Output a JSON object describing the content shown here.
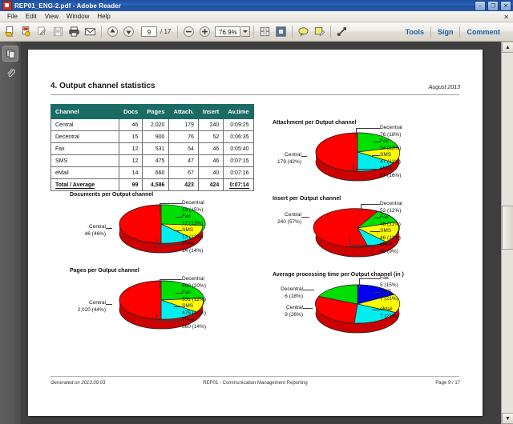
{
  "window": {
    "title": "REP01_ENG-2.pdf - Adobe Reader",
    "app_icon": "pdf-icon",
    "minimize_label": "–",
    "maximize_label": "❐",
    "close_label": "✕"
  },
  "menubar": {
    "items": [
      {
        "label": "File"
      },
      {
        "label": "Edit"
      },
      {
        "label": "View"
      },
      {
        "label": "Window"
      },
      {
        "label": "Help"
      }
    ],
    "close_doc_label": "✕"
  },
  "toolbar": {
    "icons": [
      {
        "name": "open-file-icon"
      },
      {
        "name": "create-pdf-icon"
      },
      {
        "name": "edit-pdf-icon"
      },
      {
        "name": "save-icon"
      },
      {
        "name": "print-icon"
      },
      {
        "name": "email-icon"
      },
      {
        "name": "previous-page-icon"
      },
      {
        "name": "next-page-icon"
      }
    ],
    "page_number": "9",
    "page_total": "/ 17",
    "zoom_out_icon": "zoom-out-icon",
    "zoom_in_icon": "zoom-in-icon",
    "zoom_level": "76.9%",
    "zoom_dropdown_icon": "chevron-down-icon",
    "fit_width_icon": "fit-width-icon",
    "fit_page_icon": "fit-page-icon",
    "comment_icon": "comment-balloon-icon",
    "highlight_icon": "highlight-text-icon",
    "fullscreen_icon": "fullscreen-icon",
    "right_links": [
      {
        "label": "Tools"
      },
      {
        "label": "Sign"
      },
      {
        "label": "Comment"
      }
    ]
  },
  "sidebar": {
    "items": [
      {
        "name": "page-thumbnails-icon",
        "selected": true
      },
      {
        "name": "attachments-paperclip-icon",
        "selected": false
      }
    ]
  },
  "scrollbar": {
    "up_arrow": "▲",
    "down_arrow": "▼"
  },
  "document": {
    "section_title": "4. Output channel statistics",
    "month": "August 2013",
    "table": {
      "headers": [
        "Channel",
        "Docs",
        "Pages",
        "Attach.",
        "Insert",
        "Av.time"
      ],
      "rows": [
        [
          "Central",
          "46",
          "2,020",
          "179",
          "240",
          "0:09:25"
        ],
        [
          "Decentral",
          "15",
          "900",
          "76",
          "52",
          "0:06:35"
        ],
        [
          "Fax",
          "12",
          "531",
          "54",
          "46",
          "0:05:40"
        ],
        [
          "SMS",
          "12",
          "475",
          "47",
          "46",
          "0:07:15"
        ],
        [
          "eMail",
          "14",
          "660",
          "67",
          "40",
          "0:07:16"
        ]
      ],
      "total_row": [
        "Total / Average",
        "99",
        "4,586",
        "423",
        "424",
        "0:07:14"
      ]
    },
    "footer": {
      "generated": "Generated on 2013.09.03",
      "report": "REP01 - Communication Management Reporting",
      "page": "Page 9 / 17"
    }
  },
  "colors": {
    "central": "#ff0000",
    "decentral": "#00e000",
    "fax": "#0000ee",
    "sms": "#ffff00",
    "email": "#00eeee",
    "table_header": "#1b6b65",
    "titlebar": "#1c4f9e",
    "link": "#1f5fa8"
  },
  "chart_data": [
    {
      "id": "documents",
      "type": "pie",
      "title": "Documents per Output channel",
      "categories": [
        "Central",
        "Decentral",
        "Fax",
        "SMS",
        "eMail"
      ],
      "values": [
        46,
        15,
        12,
        12,
        14
      ],
      "percents": [
        46,
        15,
        12,
        12,
        14
      ],
      "labels": [
        "Central\n46 (46%)",
        "Decentral\n15 (15%)",
        "Fax\n12 (12%)",
        "SMS\n12 (12%)",
        "eMail\n14 (14%)"
      ],
      "label_lines": [
        [
          "Central",
          "46 (46%)"
        ],
        [
          "Decentral",
          "15 (15%)"
        ],
        [
          "Fax",
          "12 (12%)"
        ],
        [
          "SMS",
          "12 (12%)"
        ],
        [
          "eMail",
          "14 (14%)"
        ]
      ],
      "colors": [
        "#ff0000",
        "#00e000",
        "#0000ee",
        "#ffff00",
        "#00eeee"
      ],
      "legend": "callout-labels"
    },
    {
      "id": "pages",
      "type": "pie",
      "title": "Pages per Output channel",
      "categories": [
        "Central",
        "Decentral",
        "Fax",
        "SMS",
        "eMail"
      ],
      "values": [
        2020,
        900,
        531,
        475,
        660
      ],
      "percents": [
        44,
        20,
        12,
        10,
        14
      ],
      "label_lines": [
        [
          "Central",
          "2,020 (44%)"
        ],
        [
          "Decentral",
          "900 (20%)"
        ],
        [
          "Fax",
          "531 (12%)"
        ],
        [
          "SMS",
          "475 (10%)"
        ],
        [
          "eMail",
          "660 (14%)"
        ]
      ],
      "colors": [
        "#ff0000",
        "#00e000",
        "#0000ee",
        "#ffff00",
        "#00eeee"
      ],
      "legend": "callout-labels"
    },
    {
      "id": "attachment",
      "type": "pie",
      "title": "Attachment per Output channel",
      "categories": [
        "Central",
        "Decentral",
        "Fax",
        "SMS",
        "eMail"
      ],
      "values": [
        179,
        76,
        54,
        47,
        67
      ],
      "percents": [
        42,
        18,
        13,
        11,
        16
      ],
      "label_lines": [
        [
          "Central",
          "179 (42%)"
        ],
        [
          "Decentral",
          "76 (18%)"
        ],
        [
          "Fax",
          "54 (13%)"
        ],
        [
          "SMS",
          "47 (11%)"
        ],
        [
          "eMail",
          "67 (16%)"
        ]
      ],
      "colors": [
        "#ff0000",
        "#00e000",
        "#0000ee",
        "#ffff00",
        "#00eeee"
      ],
      "legend": "callout-labels"
    },
    {
      "id": "insert",
      "type": "pie",
      "title": "Insert per Output channel",
      "categories": [
        "Central",
        "Decentral",
        "Fax",
        "SMS",
        "eMail"
      ],
      "values": [
        240,
        52,
        46,
        46,
        40
      ],
      "percents": [
        57,
        12,
        11,
        11,
        9
      ],
      "label_lines": [
        [
          "Central",
          "240 (57%)"
        ],
        [
          "Decentral",
          "52 (12%)"
        ],
        [
          "Fax",
          "46 (11%)"
        ],
        [
          "SMS",
          "46 (11%)"
        ],
        [
          "eMail",
          "40 (9%)"
        ]
      ],
      "colors": [
        "#ff0000",
        "#00e000",
        "#0000ee",
        "#ffff00",
        "#00eeee"
      ],
      "legend": "callout-labels"
    },
    {
      "id": "avgtime",
      "type": "pie",
      "title": "Average processing time per Output channel (in )",
      "categories": [
        "Central",
        "Decentral",
        "Fax",
        "SMS",
        "eMail"
      ],
      "values": [
        9,
        6,
        5,
        7,
        7
      ],
      "percents": [
        26,
        18,
        15,
        21,
        21
      ],
      "label_lines": [
        [
          "Central",
          "9 (26%)"
        ],
        [
          "Decentral",
          "6 (18%)"
        ],
        [
          "Fax",
          "5 (15%)"
        ],
        [
          "SMS",
          "7 (21%)"
        ],
        [
          "eMail",
          "7 (21%)"
        ]
      ],
      "colors": [
        "#ff0000",
        "#00e000",
        "#0000ee",
        "#ffff00",
        "#00eeee"
      ],
      "legend": "callout-labels"
    }
  ]
}
